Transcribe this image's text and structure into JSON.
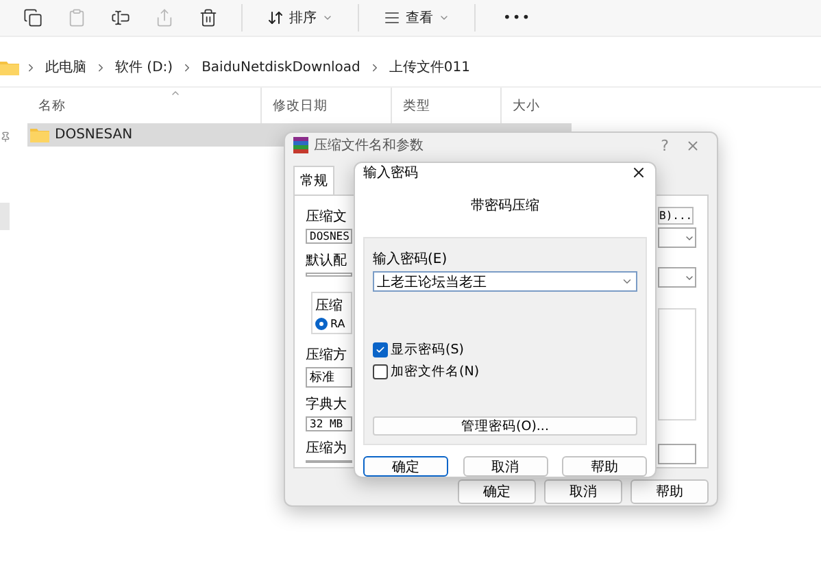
{
  "explorer": {
    "toolbar": {
      "buttons": [
        {
          "disabled": false
        },
        {
          "disabled": true
        },
        {
          "disabled": false
        },
        {
          "disabled": true
        },
        {
          "disabled": false
        }
      ],
      "sort": "排序",
      "view": "查看",
      "more": "•••"
    },
    "breadcrumb": [
      "此电脑",
      "软件 (D:)",
      "BaiduNetdiskDownload",
      "上传文件011"
    ],
    "columns": [
      "名称",
      "修改日期",
      "类型",
      "大小"
    ],
    "rows": [
      {
        "name": "DOSNESAN",
        "selected": true
      }
    ]
  },
  "archive_dialog": {
    "title": "压缩文件名和参数",
    "help": "?",
    "tabs": [
      {
        "label": "常规",
        "selected": true
      }
    ],
    "left_labels": [
      "压缩文",
      "默认配",
      "压缩方",
      "字典大",
      "压缩为"
    ],
    "archive_name": "DOSNES",
    "group_label": "压缩",
    "format_option": {
      "label": "RA",
      "selected": true
    },
    "method": "标准",
    "dictionary": "32 MB",
    "browse_button": "B)...",
    "buttons": [
      "确定",
      "取消",
      "帮助"
    ]
  },
  "password_dialog": {
    "title": "输入密码",
    "heading": "带密码压缩",
    "field_label": "输入密码(E)",
    "password": "上老王论坛当老王",
    "options": [
      {
        "label": "显示密码(S)",
        "checked": true
      },
      {
        "label": "加密文件名(N)",
        "checked": false
      }
    ],
    "manage_button": "管理密码(O)...",
    "buttons": [
      {
        "label": "确定",
        "default": true
      },
      {
        "label": "取消",
        "default": false
      },
      {
        "label": "帮助",
        "default": false
      }
    ]
  }
}
